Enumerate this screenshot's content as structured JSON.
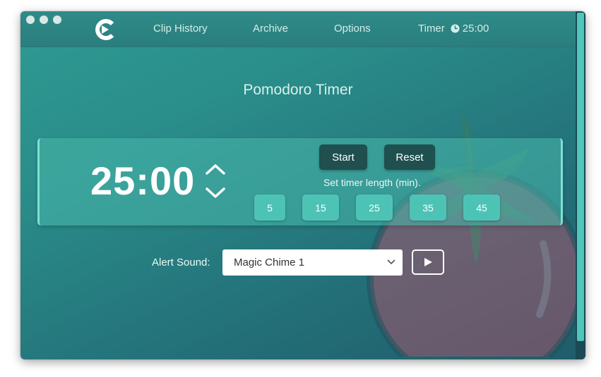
{
  "nav": {
    "items": [
      {
        "label": "Clip History"
      },
      {
        "label": "Archive"
      },
      {
        "label": "Options"
      },
      {
        "label": "Timer"
      }
    ],
    "timer_value": "25:00"
  },
  "page": {
    "title": "Pomodoro Timer"
  },
  "timer": {
    "display": "25:00",
    "start_label": "Start",
    "reset_label": "Reset",
    "length_label": "Set timer length (min).",
    "presets": [
      "5",
      "15",
      "25",
      "35",
      "45"
    ]
  },
  "alert": {
    "label": "Alert Sound:",
    "selected": "Magic Chime 1"
  },
  "icons": {
    "logo": "app-logo",
    "clock": "clock-icon",
    "up": "chevron-up-icon",
    "down": "chevron-down-icon",
    "select": "chevron-down-icon",
    "play": "play-icon"
  },
  "colors": {
    "accent": "#4dc3b6",
    "dark_button": "#1f4f4f",
    "background": "#2a8d8a"
  }
}
